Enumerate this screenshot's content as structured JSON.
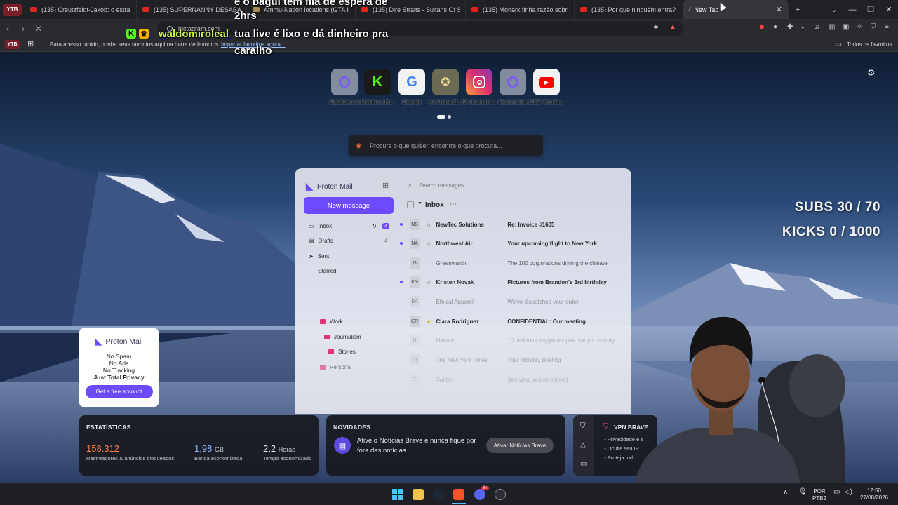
{
  "browser": {
    "profile_badge": "YTB",
    "tabs": [
      {
        "label": "(135) Creutzfeldt-Jakob: o estranho"
      },
      {
        "label": "(135) SUPERNANNY DESABAFA so"
      },
      {
        "label": "Ammu-Nation locations (GTA III) -"
      },
      {
        "label": "(135) Dire Straits - Sultans Of Swin"
      },
      {
        "label": "(135) Monark tinha razão sobre o"
      },
      {
        "label": "(135) Por que ninguém entra? - Yo"
      },
      {
        "label": "New Tab",
        "active": true
      }
    ],
    "new_tab_label": "+",
    "address": "instagram.com",
    "bookmarks_prompt": "Para acesso rápido, ponha seus favoritos aqui na barra de favoritos.",
    "bookmarks_import": "Importar favoritos agora...",
    "all_bookmarks": "Todos os favoritos"
  },
  "stream_overlay": {
    "chat_top": "e o bagui tem fila de espera de",
    "chat_top2": "2hrs",
    "chat_user": "waldomiroleal",
    "chat_msg": "tua live é lixo e dá dinheiro pra",
    "chat_msg2": "caralho",
    "subs": "SUBS 30 / 70",
    "kicks": "KICKS 0 / 1000"
  },
  "shortcuts": [
    {
      "label": "Dashboard",
      "icon": "proton-icon"
    },
    {
      "label": "OvelheraM...",
      "icon": "kick-icon"
    },
    {
      "label": "Google",
      "icon": "google-icon"
    },
    {
      "label": "Vi Arena B...",
      "icon": "arena-icon"
    },
    {
      "label": "(9) Instagra...",
      "icon": "instagram-icon"
    },
    {
      "label": "Moderador",
      "icon": "proton-icon"
    },
    {
      "label": "(135) YouTu...",
      "icon": "youtube-icon"
    }
  ],
  "search": {
    "placeholder": "Procure o que quiser. encontre o que procura..."
  },
  "protonmail": {
    "brand": "Proton Mail",
    "new_message": "New message",
    "search": "Search messages",
    "inbox_title": "Inbox",
    "folders": [
      {
        "label": "Inbox",
        "count": "4"
      },
      {
        "label": "Drafts",
        "count": "4"
      },
      {
        "label": "Sent",
        "count": ""
      },
      {
        "label": "Starred",
        "count": ""
      },
      {
        "label": "Work",
        "count": ""
      },
      {
        "label": "Journalism",
        "count": ""
      },
      {
        "label": "Stories",
        "count": ""
      },
      {
        "label": "Personal",
        "count": ""
      }
    ],
    "messages": [
      {
        "initials": "NS",
        "sender": "NewTec Solutions",
        "subject": "Re: Invoice #1605",
        "unread": true
      },
      {
        "initials": "NA",
        "sender": "Northwest Air",
        "subject": "Your upcoming flight to New York",
        "unread": true
      },
      {
        "initials": "G",
        "sender": "Greenwatch",
        "subject": "The 100 corporations driving the climate",
        "unread": false
      },
      {
        "initials": "KN",
        "sender": "Kristen Novak",
        "subject": "Pictures from Brandon's 3rd birthday",
        "unread": true
      },
      {
        "initials": "EA",
        "sender": "Ethical Apparel",
        "subject": "We've dispatched your order",
        "unread": false
      },
      {
        "initials": "CR",
        "sender": "Clara Rodriguez",
        "subject": "CONFIDENTIAL: Our meeting",
        "unread": true,
        "starred": true
      },
      {
        "initials": "H",
        "sender": "Hannah",
        "subject": "10 delicious veggie recipes that you can try",
        "unread": false
      },
      {
        "initials": "TT",
        "sender": "The New York Times",
        "subject": "Your Monday Briefing",
        "unread": false
      },
      {
        "initials": "T",
        "sender": "Twitter",
        "subject": "See what you've missed",
        "unread": false
      }
    ]
  },
  "promo": {
    "brand": "Proton Mail",
    "line1": "No Spam",
    "line2": "No Ads",
    "line3": "No Tracking",
    "line4": "Just Total Privacy",
    "cta": "Get a free account"
  },
  "stats": {
    "title": "ESTATÍSTICAS",
    "trackers_value": "158.312",
    "trackers_label": "Rastreadores & anúncios bloqueados",
    "bandwidth_value": "1,98",
    "bandwidth_unit": "GB",
    "bandwidth_label": "Banda economizada",
    "time_value": "2,2",
    "time_unit": "Horas",
    "time_label": "Tempo economizado"
  },
  "news": {
    "title": "NOVIDADES",
    "text": "Ative o Notícias Brave e nunca fique por fora das notícias",
    "button": "Ativar Notícias Brave"
  },
  "vpn": {
    "title": "VPN BRAVE",
    "items": [
      "Privacidade e s",
      "Oculte seu IP",
      "Proteja tod"
    ]
  },
  "taskbar": {
    "lang": "POR",
    "layout": "PTB2",
    "time": "12:50",
    "date": "27/08/2026",
    "discord_badge": "9+"
  },
  "colors": {
    "accent": "#6d4aff",
    "stats_orange": "#ff7a45",
    "stats_blue": "#8fb4ff"
  }
}
